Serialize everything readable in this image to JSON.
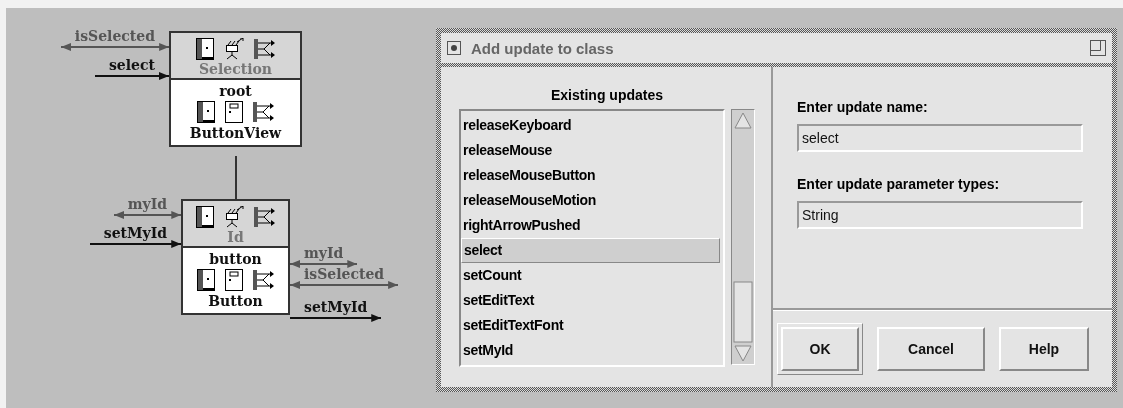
{
  "diagram": {
    "nodes": [
      {
        "header_label": "Selection",
        "name": "root",
        "class_label": "ButtonView",
        "arrows": [
          {
            "label": "isSelected",
            "on_right": false,
            "kind": "both"
          },
          {
            "label": "select",
            "on_right": false,
            "kind": "in"
          }
        ]
      },
      {
        "header_label": "Id",
        "name": "button",
        "class_label": "Button",
        "arrows": [
          {
            "label": "myId",
            "on_right": false,
            "kind": "both"
          },
          {
            "label": "setMyId",
            "on_right": false,
            "kind": "in"
          },
          {
            "label": "myId",
            "on_right": true,
            "kind": "both"
          },
          {
            "label": "isSelected",
            "on_right": true,
            "kind": "both"
          },
          {
            "label": "setMyId",
            "on_right": true,
            "kind": "out"
          }
        ]
      }
    ]
  },
  "dialog": {
    "title": "Add update to class",
    "list": {
      "heading": "Existing updates",
      "items": [
        {
          "label": "releaseKeyboard",
          "selected": false
        },
        {
          "label": "releaseMouse",
          "selected": false
        },
        {
          "label": "releaseMouseButton",
          "selected": false
        },
        {
          "label": "releaseMouseMotion",
          "selected": false
        },
        {
          "label": "rightArrowPushed",
          "selected": false
        },
        {
          "label": "select",
          "selected": true
        },
        {
          "label": "setCount",
          "selected": false
        },
        {
          "label": "setEditText",
          "selected": false
        },
        {
          "label": "setEditTextFont",
          "selected": false
        },
        {
          "label": "setMyId",
          "selected": false
        }
      ]
    },
    "fields": [
      {
        "label": "Enter update name:",
        "value": "select"
      },
      {
        "label": "Enter update parameter types:",
        "value": "String"
      }
    ],
    "buttons": [
      {
        "label": "OK",
        "default": true
      },
      {
        "label": "Cancel",
        "default": false
      },
      {
        "label": "Help",
        "default": false
      }
    ]
  }
}
